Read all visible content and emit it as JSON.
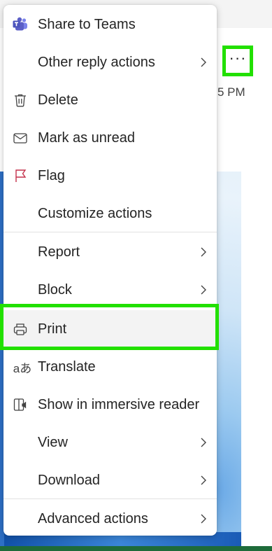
{
  "background": {
    "time_fragment": "5 PM",
    "more_button_label": "···"
  },
  "menu": {
    "items": [
      {
        "label": "Share to Teams",
        "icon": "teams-icon",
        "submenu": false
      },
      {
        "label": "Other reply actions",
        "icon": "",
        "submenu": true
      },
      {
        "label": "Delete",
        "icon": "trash-icon",
        "submenu": false
      },
      {
        "label": "Mark as unread",
        "icon": "envelope-icon",
        "submenu": false
      },
      {
        "label": "Flag",
        "icon": "flag-icon",
        "submenu": false
      },
      {
        "label": "Customize actions",
        "icon": "",
        "submenu": false
      },
      {
        "label": "Report",
        "icon": "",
        "submenu": true
      },
      {
        "label": "Block",
        "icon": "",
        "submenu": true
      },
      {
        "label": "Print",
        "icon": "printer-icon",
        "submenu": false,
        "highlighted": true
      },
      {
        "label": "Translate",
        "icon": "translate-icon",
        "submenu": false
      },
      {
        "label": "Show in immersive reader",
        "icon": "immersive-reader-icon",
        "submenu": false
      },
      {
        "label": "View",
        "icon": "",
        "submenu": true
      },
      {
        "label": "Download",
        "icon": "",
        "submenu": true
      },
      {
        "label": "Advanced actions",
        "icon": "",
        "submenu": true
      }
    ]
  },
  "colors": {
    "highlight_frame": "#22e000",
    "flag": "#c4314b",
    "teams": "#5b5fc7"
  }
}
